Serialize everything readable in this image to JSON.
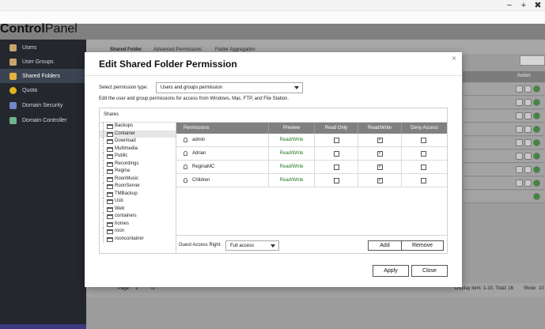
{
  "window": {
    "minimize": "−",
    "maximize": "+",
    "close": "✖"
  },
  "app": {
    "title_bold": "Control",
    "title_rest": "Panel"
  },
  "sidebar": {
    "items": [
      {
        "label": "Users",
        "icon": "user-icon",
        "color": "#c9a46b"
      },
      {
        "label": "User Groups",
        "icon": "user-group-icon",
        "color": "#c9a46b"
      },
      {
        "label": "Shared Folders",
        "icon": "shared-folder-icon",
        "color": "#e2b341"
      },
      {
        "label": "Quota",
        "icon": "quota-icon",
        "color": "#e0b520"
      },
      {
        "label": "Domain Security",
        "icon": "domain-security-icon",
        "color": "#6e87c9"
      },
      {
        "label": "Domain Controller",
        "icon": "domain-controller-icon",
        "color": "#6fb38a"
      }
    ]
  },
  "main": {
    "tabs": [
      {
        "label": "Shared Folder"
      },
      {
        "label": "Advanced Permissions"
      },
      {
        "label": "Folder Aggregation"
      }
    ],
    "action_header": "Action",
    "footer": {
      "page_label": "Page",
      "page_value": "1",
      "page_total": "/2",
      "display_text": "Display item: 1-10, Total: 16",
      "show_label": "Show",
      "show_value": "10"
    }
  },
  "dialog": {
    "title": "Edit Shared Folder Permission",
    "close_icon": "×",
    "permission_type_label": "Select permission type:",
    "permission_type_value": "Users and groups permission",
    "description": "Edit the user and group permissions for access from Windows, Mac, FTP, and File Station.",
    "shares_label": "Shares",
    "folders": [
      "Backups",
      "Container",
      "Download",
      "Multimedia",
      "Public",
      "Recordings",
      "Regina",
      "RoonMusic",
      "RoonServer",
      "TMBackup",
      "Usb",
      "Web",
      "containers",
      "homes",
      "roon",
      "rooncontainer"
    ],
    "selected_folder": "Container",
    "columns": {
      "permissions": "Permissions",
      "preview": "Preview",
      "read_only": "Read Only",
      "read_write": "Read/Write",
      "deny_access": "Deny Access"
    },
    "rows": [
      {
        "name": "admin",
        "preview": "Read/Write",
        "read_only": false,
        "read_write": true,
        "deny": false
      },
      {
        "name": "Adrian",
        "preview": "Read/Write",
        "read_only": false,
        "read_write": true,
        "deny": false
      },
      {
        "name": "ReginaMC",
        "preview": "Read/Write",
        "read_only": false,
        "read_write": true,
        "deny": false
      },
      {
        "name": "Children",
        "preview": "Read/Write",
        "read_only": false,
        "read_write": true,
        "deny": false
      }
    ],
    "check_mark": "✓",
    "guest_access_label": "Guest Access Right:",
    "guest_access_value": "Full access",
    "add_label": "Add",
    "remove_label": "Remove",
    "apply_label": "Apply",
    "close_label": "Close"
  }
}
